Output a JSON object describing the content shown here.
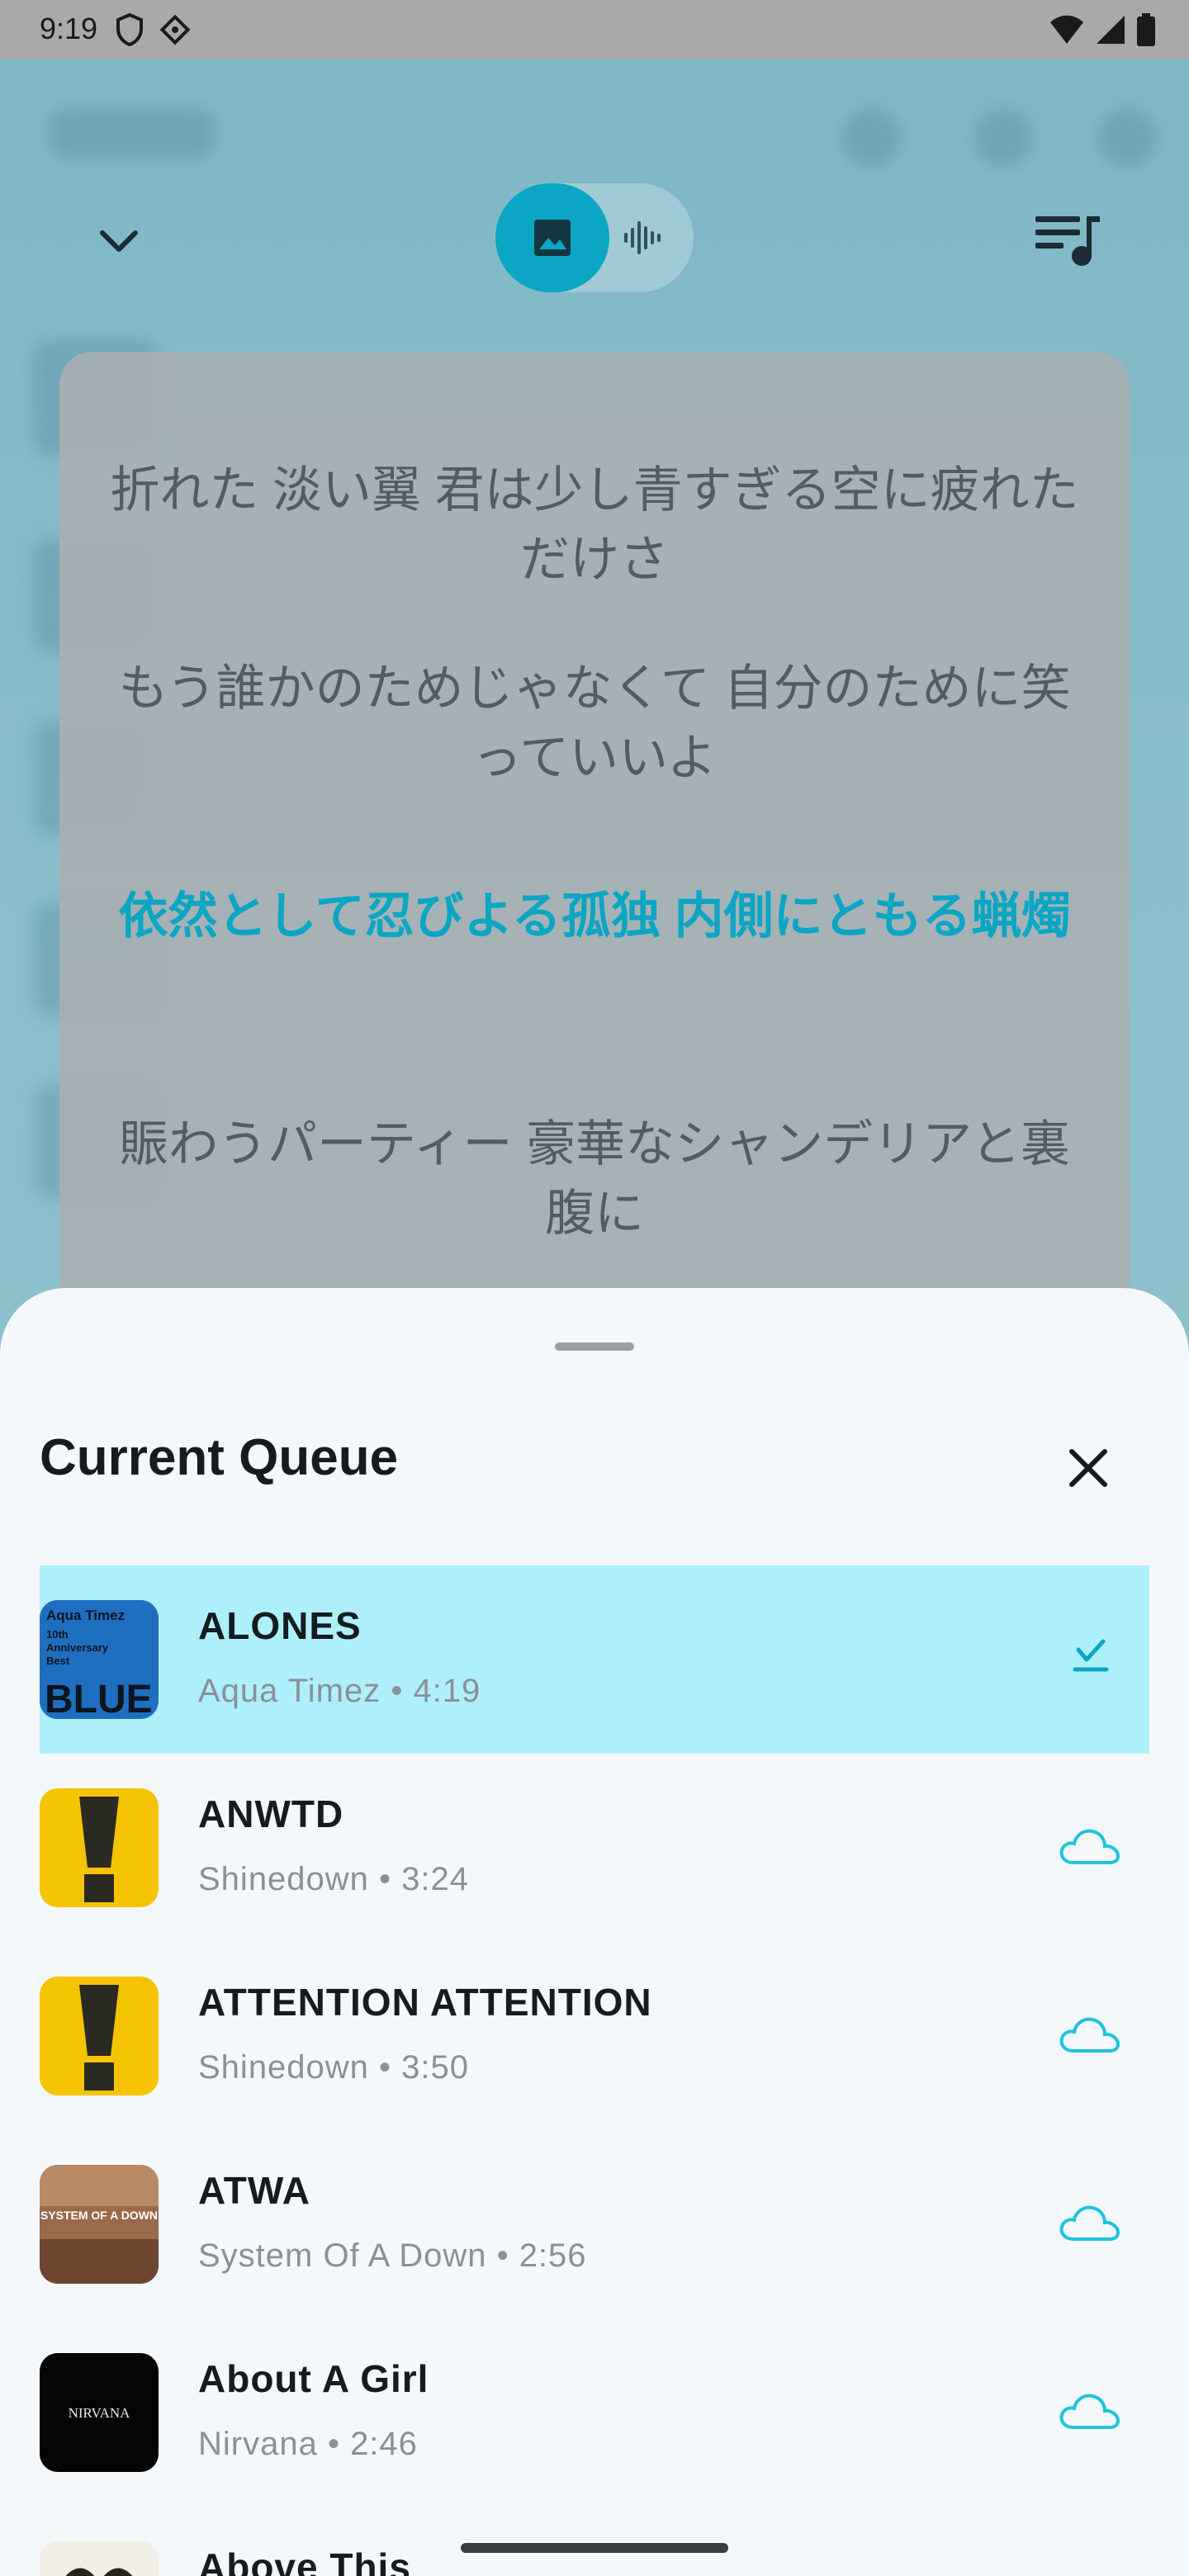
{
  "status_bar": {
    "time": "9:19"
  },
  "lyrics": [
    "折れた 淡い翼 君は少し青すぎる空に疲れただけさ",
    "もう誰かのためじゃなくて 自分のために笑っていいよ",
    "依然として忍びよる孤独 内側にともる蝋燭",
    "賑わうパーティー 豪華なシャンデリアと裏腹に"
  ],
  "queue_sheet": {
    "title": "Current Queue",
    "items": [
      {
        "title": "ALONES",
        "subtitle": "Aqua Timez • 4:19",
        "art_text": [
          "Aqua Timez",
          "10th",
          "Anniversary",
          "Best",
          "BLUE"
        ]
      },
      {
        "title": "ANWTD",
        "subtitle": "Shinedown • 3:24"
      },
      {
        "title": "ATTENTION ATTENTION",
        "subtitle": "Shinedown • 3:50"
      },
      {
        "title": "ATWA",
        "subtitle": "System Of A Down • 2:56",
        "art_text": [
          "SYSTEM OF A DOWN"
        ]
      },
      {
        "title": "About A Girl",
        "subtitle": "Nirvana • 2:46",
        "art_text": [
          "NIRVANA"
        ]
      },
      {
        "title": "Above This",
        "subtitle": ""
      }
    ]
  },
  "colors": {
    "accent": "#0aa6c4",
    "highlight": "#aef0fa",
    "cloud": "#1ec3e0"
  }
}
